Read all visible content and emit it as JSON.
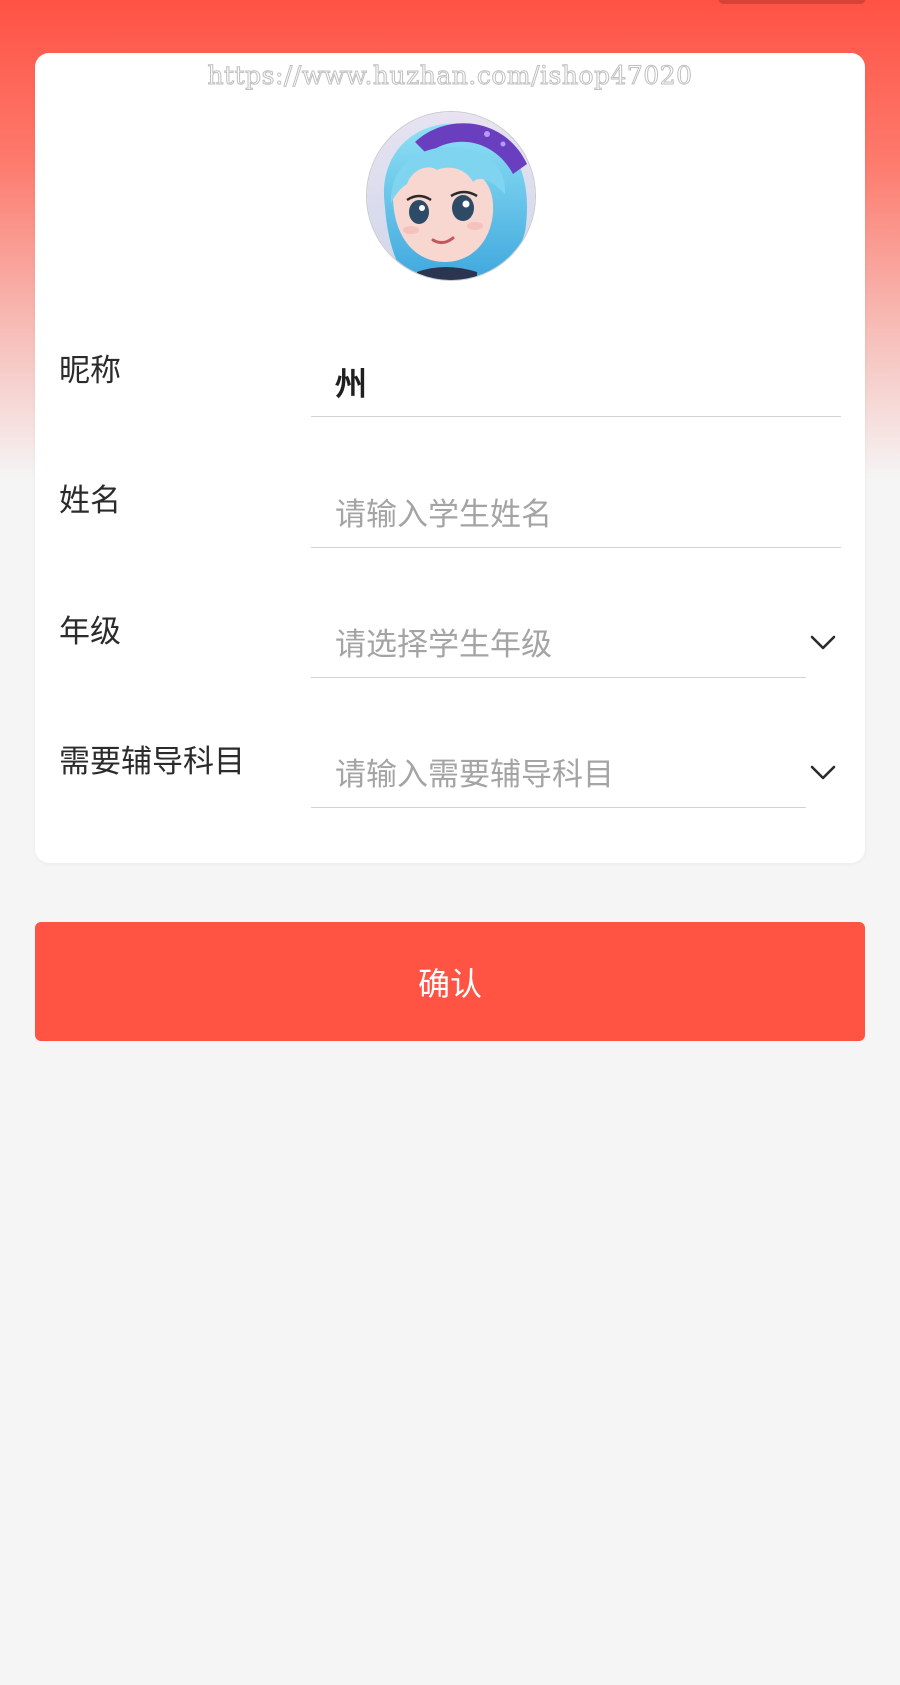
{
  "watermark": "https://www.huzhan.com/ishop47020",
  "form": {
    "nickname_label": "昵称",
    "nickname_value": "州",
    "name_label": "姓名",
    "name_placeholder": "请输入学生姓名",
    "grade_label": "年级",
    "grade_placeholder": "请选择学生年级",
    "subject_label": "需要辅导科目",
    "subject_placeholder": "请输入需要辅导科目"
  },
  "icons": {
    "avatar": "avatar-image",
    "grade_dropdown": "chevron-down-icon",
    "subject_dropdown": "chevron-down-icon"
  },
  "actions": {
    "confirm_label": "确认"
  },
  "colors": {
    "accent": "#ff5344",
    "background": "#f5f5f5"
  }
}
